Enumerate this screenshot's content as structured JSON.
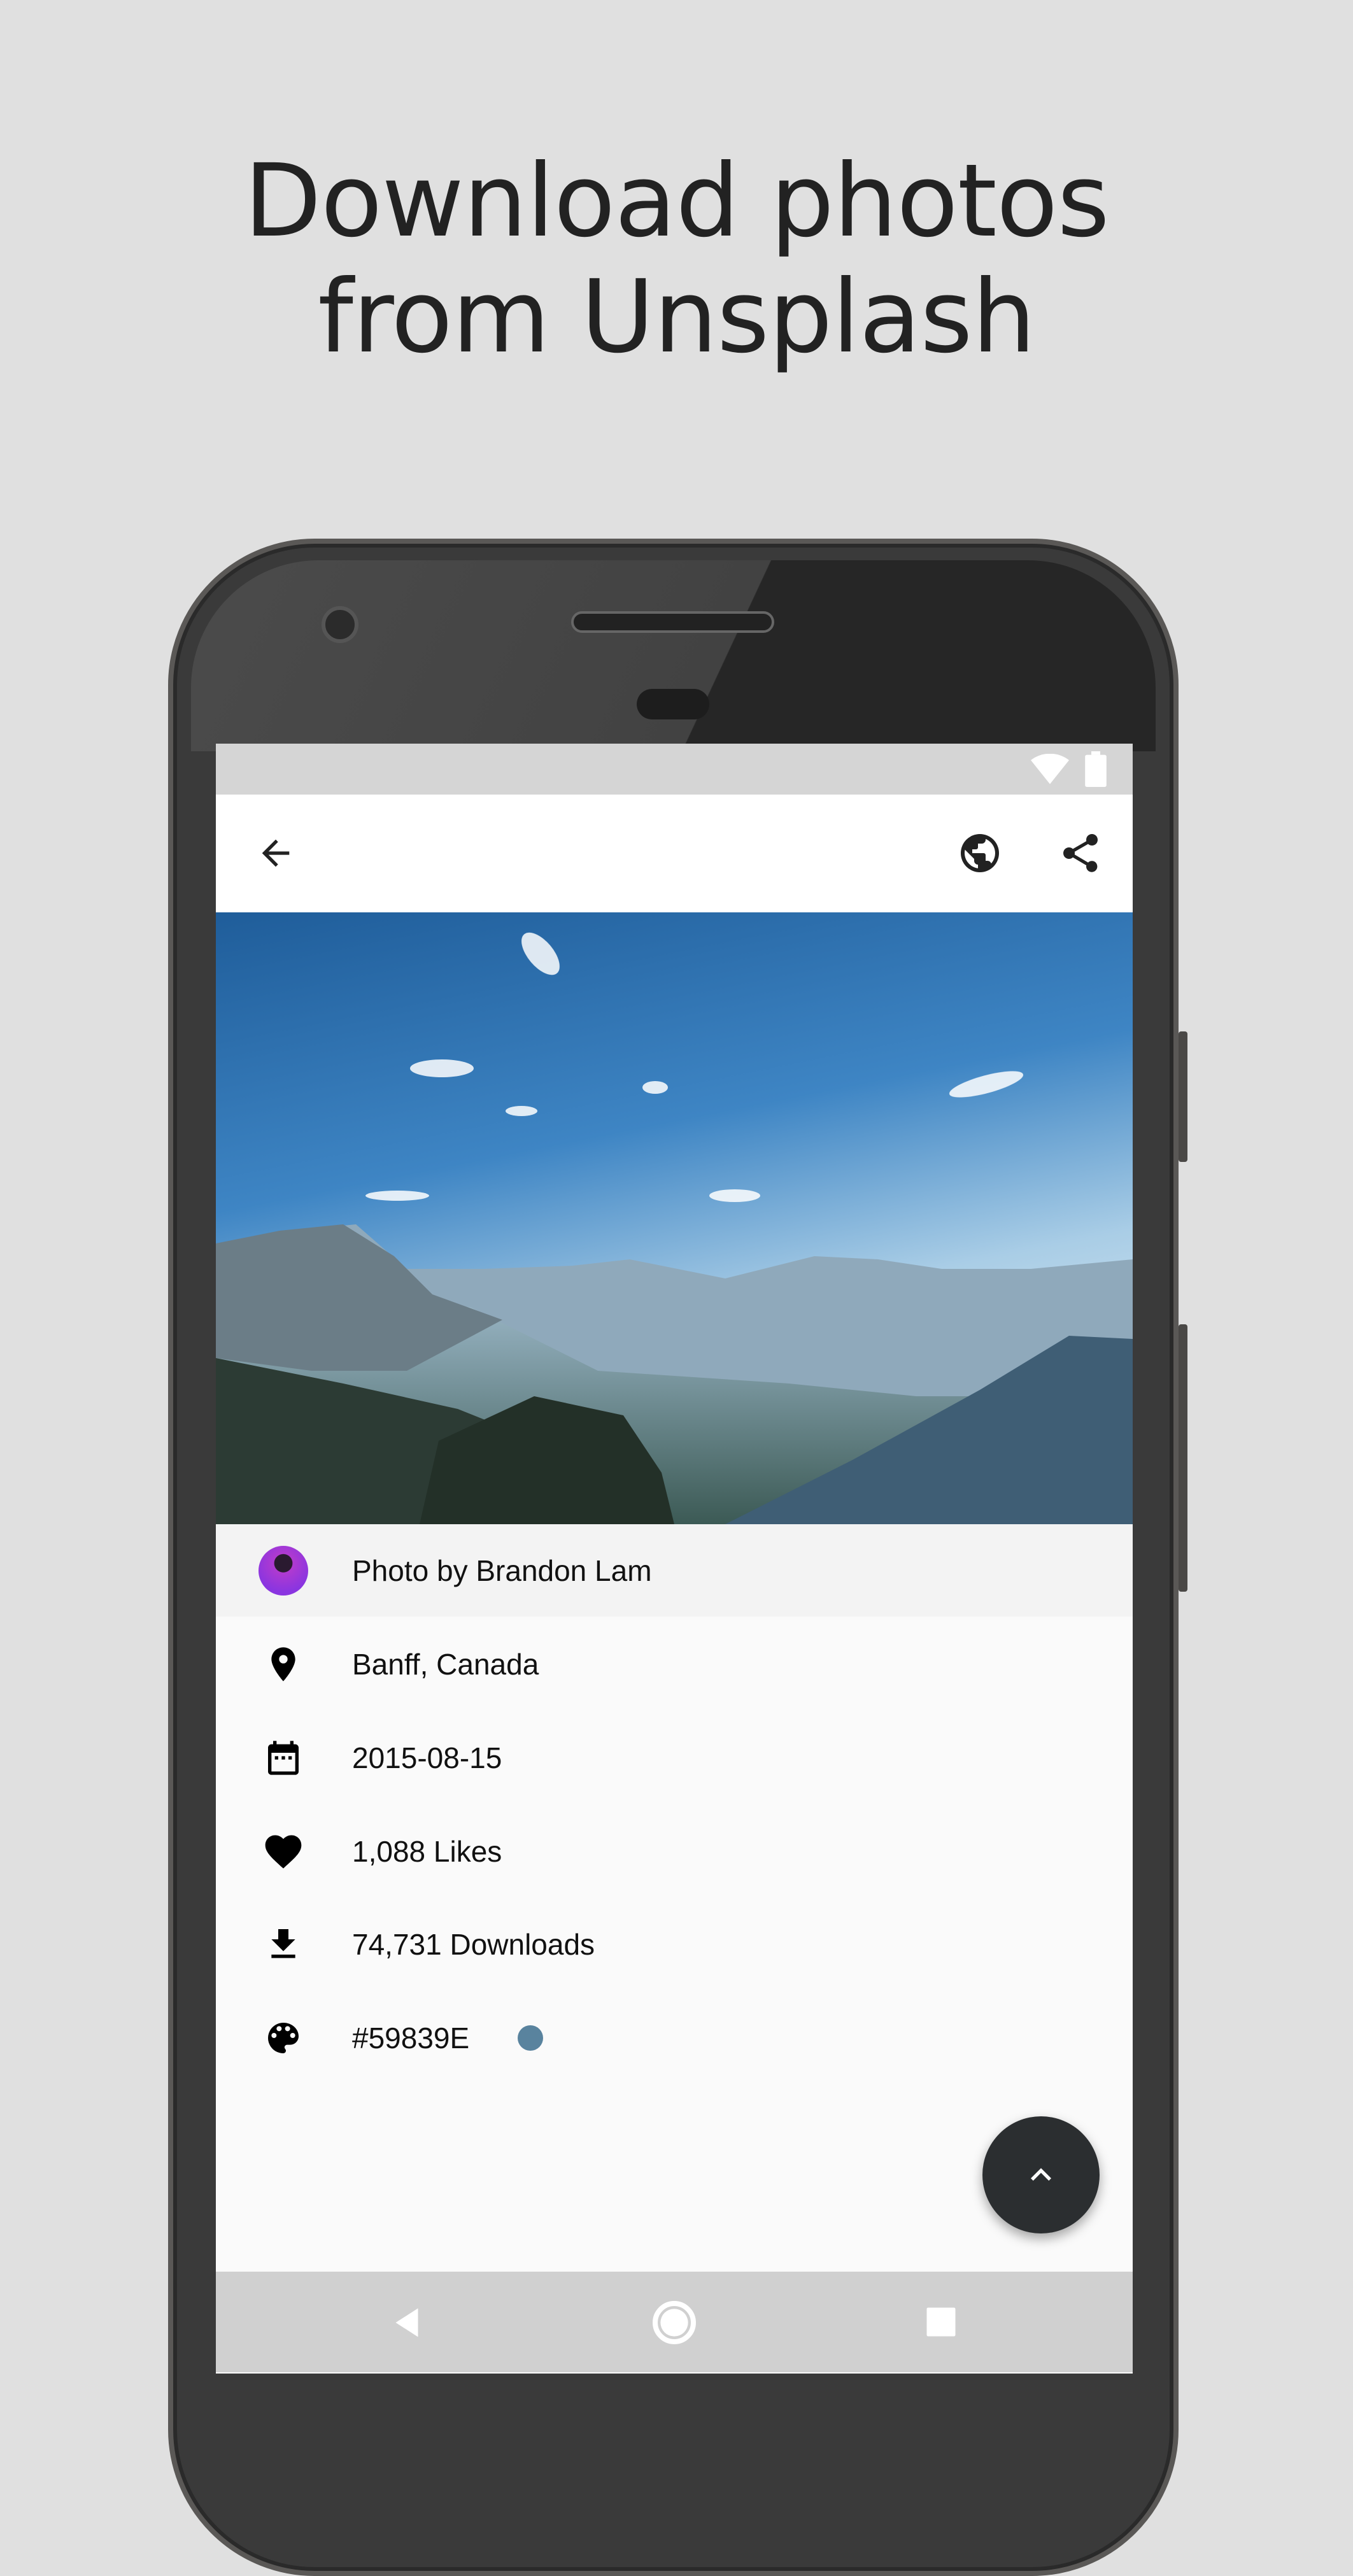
{
  "headline": {
    "line1": "Download photos",
    "line2": "from Unsplash"
  },
  "toolbar": {
    "back_icon": "arrow-back-icon",
    "globe_icon": "globe-icon",
    "share_icon": "share-icon"
  },
  "status_bar": {
    "icons": [
      "wifi-icon",
      "battery-icon"
    ]
  },
  "photo": {
    "subject": "mountain-landscape"
  },
  "details": {
    "author": "Photo by Brandon Lam",
    "location": "Banff, Canada",
    "date": "2015-08-15",
    "likes": "1,088 Likes",
    "downloads": "74,731 Downloads",
    "color": "#59839E"
  },
  "colors": {
    "swatch": "#59839E",
    "fab": "#2b2e30"
  }
}
